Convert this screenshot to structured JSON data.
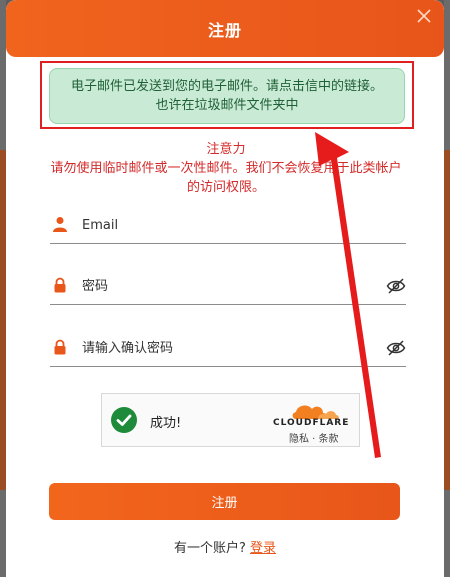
{
  "modal": {
    "title": "注册"
  },
  "notice": {
    "line1": "电子邮件已发送到您的电子邮件。请点击信中的链接。",
    "line2": "也许在垃圾邮件文件夹中"
  },
  "warning": {
    "title": "注意力",
    "line1": "请勿使用临时邮件或一次性邮件。我们不会恢复用于此类帐户",
    "line2": "的访问权限。"
  },
  "form": {
    "email_placeholder": "Email",
    "password_placeholder": "密码",
    "confirm_placeholder": "请输入确认密码"
  },
  "captcha": {
    "status": "成功!",
    "brand": "CLOUDFLARE",
    "links": "隐私 · 条款"
  },
  "submit": {
    "label": "注册"
  },
  "login": {
    "prompt": "有一个账户?",
    "link": "登录"
  },
  "colors": {
    "accent": "#e8561a",
    "notice_bg": "#c9ebd5",
    "warning_text": "#d42a2a",
    "annotation": "#e02020",
    "success": "#1e8b3a"
  },
  "icons": {
    "close": "close-icon",
    "email": "user-icon",
    "password": "lock-icon",
    "visibility": "eye-off-icon",
    "captcha": "check-icon",
    "brand": "cloudflare-icon"
  }
}
